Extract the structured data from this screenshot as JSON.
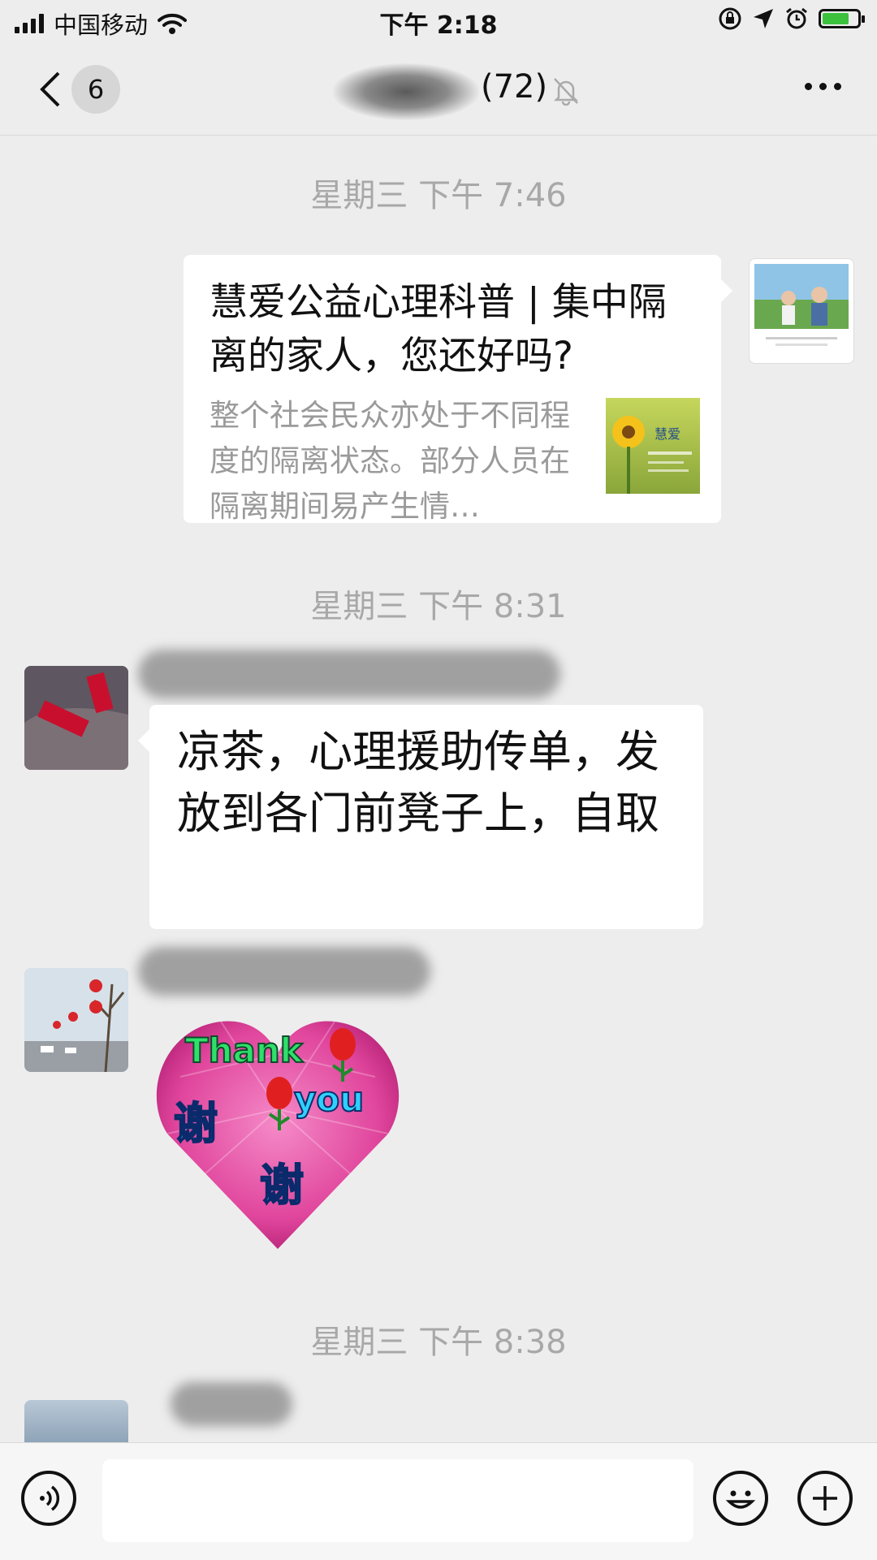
{
  "status_bar": {
    "carrier": "中国移动",
    "time": "下午 2:18",
    "battery_level": 0.75
  },
  "nav": {
    "unread_count": "6",
    "title_suffix": "(72)"
  },
  "chat": {
    "timestamps": [
      "星期三 下午 7:46",
      "星期三 下午 8:31",
      "星期三 下午 8:38"
    ],
    "article_card": {
      "title": "慧爱公益心理科普 | 集中隔离的家人，您还好吗?",
      "description": "整个社会民众亦处于不同程度的隔离状态。部分人员在隔离期间易产生情…",
      "thumb_brand": "慧爱"
    },
    "text_message": "凉茶，心理援助传单，发放到各门前凳子上，自取",
    "sticker": {
      "line1": "Thank",
      "line2": "you",
      "char1": "谢",
      "char2": "谢"
    }
  },
  "colors": {
    "background": "#ededed",
    "bubble": "#ffffff",
    "timestamp": "#a8a8a8",
    "battery": "#3cc13c",
    "sticker_pink": "#e0459c"
  }
}
